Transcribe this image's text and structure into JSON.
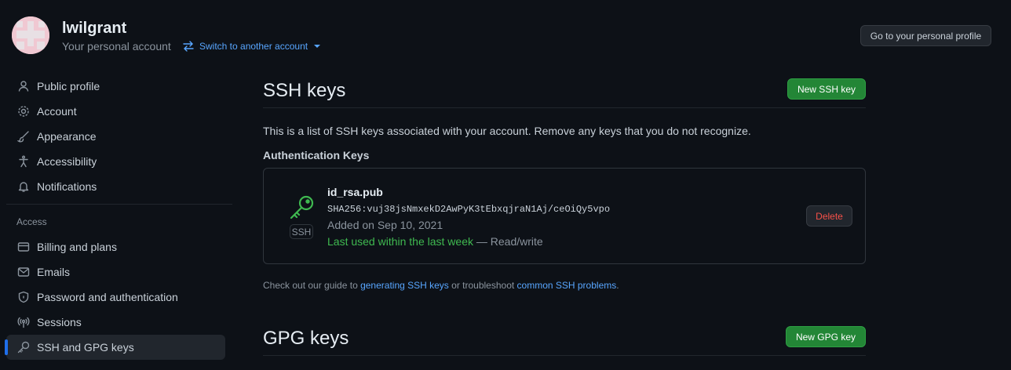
{
  "header": {
    "username": "lwilgrant",
    "account_type": "Your personal account",
    "switch_account": "Switch to another account",
    "profile_button": "Go to your personal profile"
  },
  "sidebar": {
    "items": [
      {
        "label": "Public profile",
        "icon": "person-icon"
      },
      {
        "label": "Account",
        "icon": "gear-icon"
      },
      {
        "label": "Appearance",
        "icon": "paintbrush-icon"
      },
      {
        "label": "Accessibility",
        "icon": "accessibility-icon"
      },
      {
        "label": "Notifications",
        "icon": "bell-icon"
      }
    ],
    "access_section": "Access",
    "access_items": [
      {
        "label": "Billing and plans",
        "icon": "credit-card-icon"
      },
      {
        "label": "Emails",
        "icon": "mail-icon"
      },
      {
        "label": "Password and authentication",
        "icon": "shield-lock-icon"
      },
      {
        "label": "Sessions",
        "icon": "broadcast-icon"
      },
      {
        "label": "SSH and GPG keys",
        "icon": "key-icon",
        "selected": true
      }
    ]
  },
  "ssh": {
    "title": "SSH keys",
    "new_button": "New SSH key",
    "description": "This is a list of SSH keys associated with your account. Remove any keys that you do not recognize.",
    "auth_heading": "Authentication Keys",
    "key": {
      "type_label": "SSH",
      "name": "id_rsa.pub",
      "fingerprint": "SHA256:vuj38jsNmxekD2AwPyK3tEbxqjraN1Aj/ceOiQy5vpo",
      "added": "Added on Sep 10, 2021",
      "last_used": "Last used within the last week",
      "access": " — Read/write",
      "delete_button": "Delete"
    },
    "guide": {
      "prefix": "Check out our guide to ",
      "link1": "generating SSH keys",
      "middle": " or troubleshoot ",
      "link2": "common SSH problems",
      "suffix": "."
    }
  },
  "gpg": {
    "title": "GPG keys",
    "new_button": "New GPG key"
  },
  "colors": {
    "background": "#0d1117",
    "accent": "#58a6ff",
    "green_button": "#238636",
    "danger": "#f85149",
    "success_text": "#3fb950"
  }
}
